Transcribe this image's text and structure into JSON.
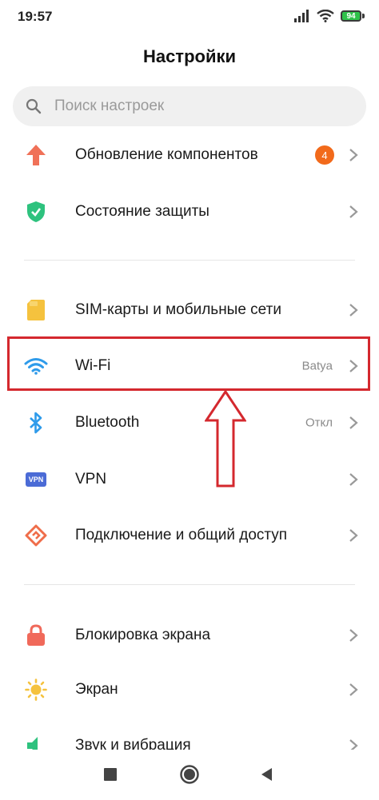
{
  "status_bar": {
    "time": "19:57",
    "battery": "94",
    "icons": [
      "signal-icon",
      "wifi-icon",
      "battery-icon"
    ]
  },
  "header": {
    "title": "Настройки"
  },
  "search": {
    "placeholder": "Поиск настроек",
    "icon": "search-icon"
  },
  "items": [
    {
      "label": "Обновление компонентов",
      "badge": "4",
      "icon": "update-arrow-icon",
      "color": "#f07158"
    },
    {
      "label": "Состояние защиты",
      "icon": "shield-check-icon",
      "color": "#2ec27e"
    },
    {
      "label": "SIM-карты и мобильные сети",
      "icon": "sim-card-icon",
      "color": "#f5c23e"
    },
    {
      "label": "Wi-Fi",
      "value": "Batya",
      "icon": "wifi-icon",
      "color": "#2f9bea"
    },
    {
      "label": "Bluetooth",
      "value": "Откл",
      "icon": "bluetooth-icon",
      "color": "#2f9bea"
    },
    {
      "label": "VPN",
      "icon": "vpn-icon",
      "icon_text": "VPN",
      "color": "#4b6bd6"
    },
    {
      "label": "Подключение и общий доступ",
      "icon": "connection-sharing-icon",
      "color": "#ef6d4a"
    },
    {
      "label": "Блокировка экрана",
      "icon": "lock-icon",
      "color": "#f0695a"
    },
    {
      "label": "Экран",
      "icon": "sun-icon",
      "color": "#f5c23e"
    },
    {
      "label": "Звук и вибрация",
      "icon": "sound-icon",
      "color": "#2ec27e"
    }
  ],
  "annotation": {
    "highlight_color": "#d4282e",
    "highlighted_item": "Wi-Fi"
  },
  "nav_bar": {
    "buttons": [
      "recents-button",
      "home-button",
      "back-button"
    ]
  }
}
